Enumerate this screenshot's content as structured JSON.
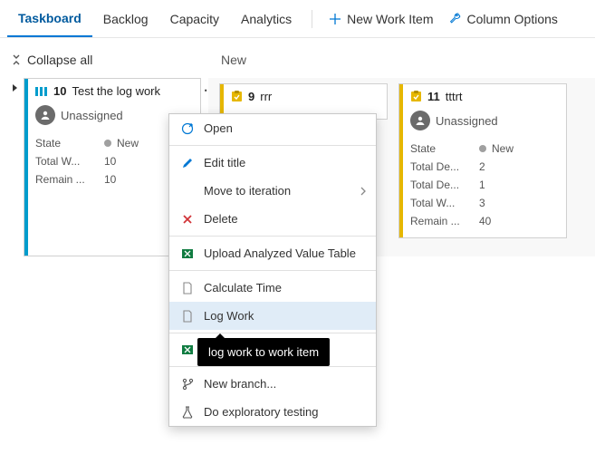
{
  "colors": {
    "accent": "#0078d4",
    "pbiStripe": "#009ccc",
    "taskStripe": "#e6b700"
  },
  "tabs": [
    {
      "label": "Taskboard",
      "active": true
    },
    {
      "label": "Backlog",
      "active": false
    },
    {
      "label": "Capacity",
      "active": false
    },
    {
      "label": "Analytics",
      "active": false
    }
  ],
  "actions": {
    "newItem": "New Work Item",
    "columnOptions": "Column Options"
  },
  "collapseAll": "Collapse all",
  "columnHeader": "New",
  "pbiCard": {
    "id": "10",
    "title": "Test the log work",
    "assignee": "Unassigned",
    "fields": [
      {
        "label": "State",
        "value": "New",
        "dot": true
      },
      {
        "label": "Total W...",
        "value": "10"
      },
      {
        "label": "Remain ...",
        "value": "10"
      }
    ]
  },
  "tasks": [
    {
      "id": "9",
      "title": "rrr"
    },
    {
      "id": "11",
      "title": "tttrt",
      "assignee": "Unassigned",
      "fields": [
        {
          "label": "State",
          "value": "New",
          "dot": true
        },
        {
          "label": "Total De...",
          "value": "2"
        },
        {
          "label": "Total De...",
          "value": "1"
        },
        {
          "label": "Total W...",
          "value": "3"
        },
        {
          "label": "Remain ...",
          "value": "40"
        }
      ]
    }
  ],
  "contextMenu": {
    "open": "Open",
    "editTitle": "Edit title",
    "moveToIteration": "Move to iteration",
    "delete": "Delete",
    "uploadTable": "Upload Analyzed Value Table",
    "calcTime": "Calculate Time",
    "logWork": "Log Work",
    "unknown": "",
    "newBranch": "New branch...",
    "exploratory": "Do exploratory testing"
  },
  "tooltip": "log work to work item"
}
